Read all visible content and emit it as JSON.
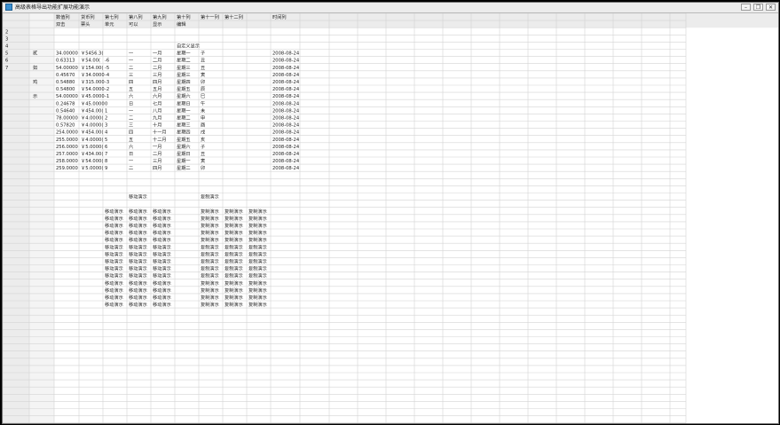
{
  "window": {
    "title": "高级表格导出功能扩展功能演示",
    "buttons": {
      "minimize": "–",
      "restore": "❐",
      "close": "✕"
    }
  },
  "colors": {
    "grid": "#d4d4d4",
    "header_bg": "#ececec",
    "text": "#222222"
  },
  "sheet": {
    "row_headers": [
      "2",
      "3",
      "4",
      "5",
      "6",
      "7"
    ],
    "column_headers_row1": [
      "数值列",
      "货币列",
      "第七列",
      "第八列",
      "第九列",
      "第十列",
      "第十一列",
      "第十二列",
      "",
      "时间列"
    ],
    "column_headers_row2": [
      "双击",
      "票头",
      "单元",
      "可以",
      "显示",
      "编辑",
      "",
      "",
      "",
      ""
    ],
    "banner_cell": "自定义显示",
    "side_labels": [
      "贰",
      "如",
      "鸡",
      "示"
    ],
    "data_rows": [
      [
        "34.00000",
        "￥5456.3(",
        "",
        "一",
        "一月",
        "星期一",
        "子",
        "2008-08-24"
      ],
      [
        "0.63313",
        "￥54.00(",
        "-6",
        "一",
        "二月",
        "星期二",
        "丑",
        "2008-08-24"
      ],
      [
        "54.00000",
        "￥154.00(",
        "-5",
        "二",
        "二月",
        "星期三",
        "丑",
        "2008-08-24"
      ],
      [
        "0.45670",
        "￥34.0000",
        "-4",
        "三",
        "三月",
        "星期三",
        "寅",
        "2008-08-24"
      ],
      [
        "0.54880",
        "￥315.000",
        "-3",
        "四",
        "四月",
        "星期四",
        "卯",
        "2008-08-24"
      ],
      [
        "0.54800",
        "￥54.0000",
        "-2",
        "五",
        "五月",
        "星期五",
        "辰",
        "2008-08-24"
      ],
      [
        "54.00000",
        "￥45.0000",
        "-1",
        "六",
        "六月",
        "星期六",
        "巳",
        "2008-08-24"
      ],
      [
        "0.24678",
        "￥45.0000",
        "0",
        "日",
        "七月",
        "星期日",
        "午",
        "2008-08-24"
      ],
      [
        "0.54640",
        "￥454.00(",
        "1",
        "一",
        "八月",
        "星期一",
        "未",
        "2008-08-24"
      ],
      [
        "78.00000",
        "￥4.0000(",
        "2",
        "二",
        "九月",
        "星期二",
        "申",
        "2008-08-24"
      ],
      [
        "0.57820",
        "￥4.0000(",
        "3",
        "三",
        "十月",
        "星期三",
        "酉",
        "2008-08-24"
      ],
      [
        "254.0000",
        "￥454.00(",
        "4",
        "四",
        "十一月",
        "星期四",
        "戌",
        "2008-08-24"
      ],
      [
        "255.0000",
        "￥4.0000(",
        "5",
        "五",
        "十二月",
        "星期五",
        "亥",
        "2008-08-24"
      ],
      [
        "256.0000",
        "￥5.0000(",
        "6",
        "六",
        "一月",
        "星期六",
        "子",
        "2008-08-24"
      ],
      [
        "257.0000",
        "￥434.00(",
        "7",
        "日",
        "二月",
        "星期日",
        "丑",
        "2008-08-24"
      ],
      [
        "258.0000",
        "￥54.000(",
        "8",
        "一",
        "三月",
        "星期一",
        "寅",
        "2008-08-24"
      ],
      [
        "259.0000",
        "￥5.0000(",
        "9",
        "二",
        "四月",
        "星期二",
        "卯",
        "2008-08-24"
      ]
    ],
    "move_section": {
      "left_header": "移动演示",
      "right_header": "复制演示",
      "left_rows": [
        [
          "移动演示",
          "移动演示",
          "移动演示"
        ],
        [
          "移动演示",
          "移动演示",
          "移动演示"
        ],
        [
          "移动演示",
          "移动演示",
          "移动演示"
        ],
        [
          "移动演示",
          "移动演示",
          "移动演示"
        ],
        [
          "移动演示",
          "移动演示",
          "移动演示"
        ],
        [
          "移动演示",
          "移动演示",
          "移动演示"
        ],
        [
          "移动演示",
          "移动演示",
          "移动演示"
        ],
        [
          "移动演示",
          "移动演示",
          "移动演示"
        ],
        [
          "移动演示",
          "移动演示",
          "移动演示"
        ],
        [
          "移动演示",
          "移动演示",
          "移动演示"
        ],
        [
          "移动演示",
          "移动演示",
          "移动演示"
        ],
        [
          "移动演示",
          "移动演示",
          "移动演示"
        ],
        [
          "移动演示",
          "移动演示",
          "移动演示"
        ],
        [
          "移动演示",
          "移动演示",
          "移动演示"
        ]
      ],
      "right_rows": [
        [
          "复制演示",
          "复制演示",
          "复制演示"
        ],
        [
          "复制演示",
          "复制演示",
          "复制演示"
        ],
        [
          "复制演示",
          "复制演示",
          "复制演示"
        ],
        [
          "复制演示",
          "复制演示",
          "复制演示"
        ],
        [
          "复制演示",
          "复制演示",
          "复制演示"
        ],
        [
          "复制演示",
          "复制演示",
          "复制演示"
        ],
        [
          "复制演示",
          "复制演示",
          "复制演示"
        ],
        [
          "复制演示",
          "复制演示",
          "复制演示"
        ],
        [
          "复制演示",
          "复制演示",
          "复制演示"
        ],
        [
          "复制演示",
          "复制演示",
          "复制演示"
        ],
        [
          "复制演示",
          "复制演示",
          "复制演示"
        ],
        [
          "复制演示",
          "复制演示",
          "复制演示"
        ],
        [
          "复制演示",
          "复制演示",
          "复制演示"
        ],
        [
          "复制演示",
          "复制演示",
          "复制演示"
        ]
      ]
    }
  }
}
